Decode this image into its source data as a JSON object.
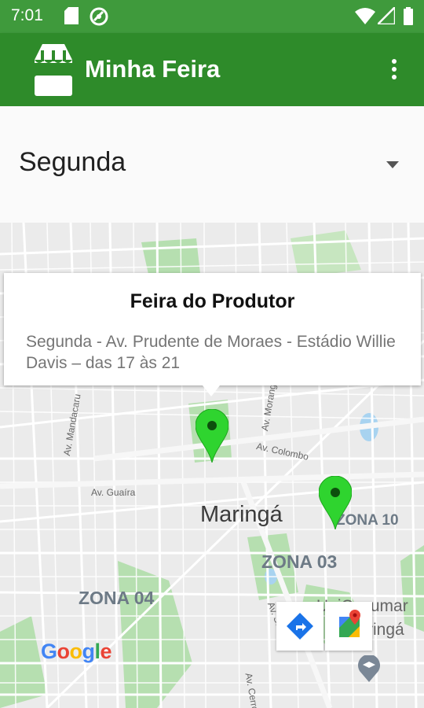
{
  "status": {
    "time": "7:01"
  },
  "appbar": {
    "title": "Minha Feira"
  },
  "day_selector": {
    "selected": "Segunda"
  },
  "map": {
    "city": "Maringá",
    "zones": [
      "ZONA 10",
      "ZONA 03",
      "ZONA 04"
    ],
    "streets": [
      "Av. Guaíra",
      "Av. Colombo",
      "Av. Mandacaru",
      "Av. Morang",
      "Av. São P",
      "Av. Cerro"
    ],
    "place": {
      "line1": "UniCesumar",
      "line2": "ringá"
    },
    "attribution": "Google"
  },
  "info_window": {
    "title": "Feira do Produtor",
    "description": "Segunda - Av. Prudente de Moraes - Estádio Willie Davis – das 17 às 21"
  },
  "colors": {
    "appbar": "#2e8b2a",
    "statusbar": "#3f9a3c",
    "pin": "#2fd42f"
  }
}
